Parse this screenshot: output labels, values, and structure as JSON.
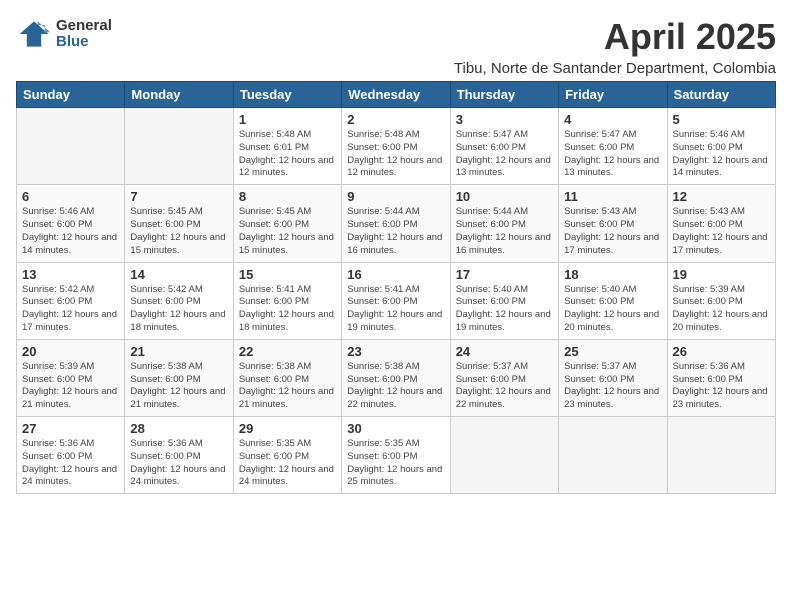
{
  "logo": {
    "general": "General",
    "blue": "Blue"
  },
  "title": "April 2025",
  "location": "Tibu, Norte de Santander Department, Colombia",
  "days_of_week": [
    "Sunday",
    "Monday",
    "Tuesday",
    "Wednesday",
    "Thursday",
    "Friday",
    "Saturday"
  ],
  "weeks": [
    [
      {
        "day": "",
        "info": ""
      },
      {
        "day": "",
        "info": ""
      },
      {
        "day": "1",
        "info": "Sunrise: 5:48 AM\nSunset: 6:01 PM\nDaylight: 12 hours and 12 minutes."
      },
      {
        "day": "2",
        "info": "Sunrise: 5:48 AM\nSunset: 6:00 PM\nDaylight: 12 hours and 12 minutes."
      },
      {
        "day": "3",
        "info": "Sunrise: 5:47 AM\nSunset: 6:00 PM\nDaylight: 12 hours and 13 minutes."
      },
      {
        "day": "4",
        "info": "Sunrise: 5:47 AM\nSunset: 6:00 PM\nDaylight: 12 hours and 13 minutes."
      },
      {
        "day": "5",
        "info": "Sunrise: 5:46 AM\nSunset: 6:00 PM\nDaylight: 12 hours and 14 minutes."
      }
    ],
    [
      {
        "day": "6",
        "info": "Sunrise: 5:46 AM\nSunset: 6:00 PM\nDaylight: 12 hours and 14 minutes."
      },
      {
        "day": "7",
        "info": "Sunrise: 5:45 AM\nSunset: 6:00 PM\nDaylight: 12 hours and 15 minutes."
      },
      {
        "day": "8",
        "info": "Sunrise: 5:45 AM\nSunset: 6:00 PM\nDaylight: 12 hours and 15 minutes."
      },
      {
        "day": "9",
        "info": "Sunrise: 5:44 AM\nSunset: 6:00 PM\nDaylight: 12 hours and 16 minutes."
      },
      {
        "day": "10",
        "info": "Sunrise: 5:44 AM\nSunset: 6:00 PM\nDaylight: 12 hours and 16 minutes."
      },
      {
        "day": "11",
        "info": "Sunrise: 5:43 AM\nSunset: 6:00 PM\nDaylight: 12 hours and 17 minutes."
      },
      {
        "day": "12",
        "info": "Sunrise: 5:43 AM\nSunset: 6:00 PM\nDaylight: 12 hours and 17 minutes."
      }
    ],
    [
      {
        "day": "13",
        "info": "Sunrise: 5:42 AM\nSunset: 6:00 PM\nDaylight: 12 hours and 17 minutes."
      },
      {
        "day": "14",
        "info": "Sunrise: 5:42 AM\nSunset: 6:00 PM\nDaylight: 12 hours and 18 minutes."
      },
      {
        "day": "15",
        "info": "Sunrise: 5:41 AM\nSunset: 6:00 PM\nDaylight: 12 hours and 18 minutes."
      },
      {
        "day": "16",
        "info": "Sunrise: 5:41 AM\nSunset: 6:00 PM\nDaylight: 12 hours and 19 minutes."
      },
      {
        "day": "17",
        "info": "Sunrise: 5:40 AM\nSunset: 6:00 PM\nDaylight: 12 hours and 19 minutes."
      },
      {
        "day": "18",
        "info": "Sunrise: 5:40 AM\nSunset: 6:00 PM\nDaylight: 12 hours and 20 minutes."
      },
      {
        "day": "19",
        "info": "Sunrise: 5:39 AM\nSunset: 6:00 PM\nDaylight: 12 hours and 20 minutes."
      }
    ],
    [
      {
        "day": "20",
        "info": "Sunrise: 5:39 AM\nSunset: 6:00 PM\nDaylight: 12 hours and 21 minutes."
      },
      {
        "day": "21",
        "info": "Sunrise: 5:38 AM\nSunset: 6:00 PM\nDaylight: 12 hours and 21 minutes."
      },
      {
        "day": "22",
        "info": "Sunrise: 5:38 AM\nSunset: 6:00 PM\nDaylight: 12 hours and 21 minutes."
      },
      {
        "day": "23",
        "info": "Sunrise: 5:38 AM\nSunset: 6:00 PM\nDaylight: 12 hours and 22 minutes."
      },
      {
        "day": "24",
        "info": "Sunrise: 5:37 AM\nSunset: 6:00 PM\nDaylight: 12 hours and 22 minutes."
      },
      {
        "day": "25",
        "info": "Sunrise: 5:37 AM\nSunset: 6:00 PM\nDaylight: 12 hours and 23 minutes."
      },
      {
        "day": "26",
        "info": "Sunrise: 5:36 AM\nSunset: 6:00 PM\nDaylight: 12 hours and 23 minutes."
      }
    ],
    [
      {
        "day": "27",
        "info": "Sunrise: 5:36 AM\nSunset: 6:00 PM\nDaylight: 12 hours and 24 minutes."
      },
      {
        "day": "28",
        "info": "Sunrise: 5:36 AM\nSunset: 6:00 PM\nDaylight: 12 hours and 24 minutes."
      },
      {
        "day": "29",
        "info": "Sunrise: 5:35 AM\nSunset: 6:00 PM\nDaylight: 12 hours and 24 minutes."
      },
      {
        "day": "30",
        "info": "Sunrise: 5:35 AM\nSunset: 6:00 PM\nDaylight: 12 hours and 25 minutes."
      },
      {
        "day": "",
        "info": ""
      },
      {
        "day": "",
        "info": ""
      },
      {
        "day": "",
        "info": ""
      }
    ]
  ]
}
